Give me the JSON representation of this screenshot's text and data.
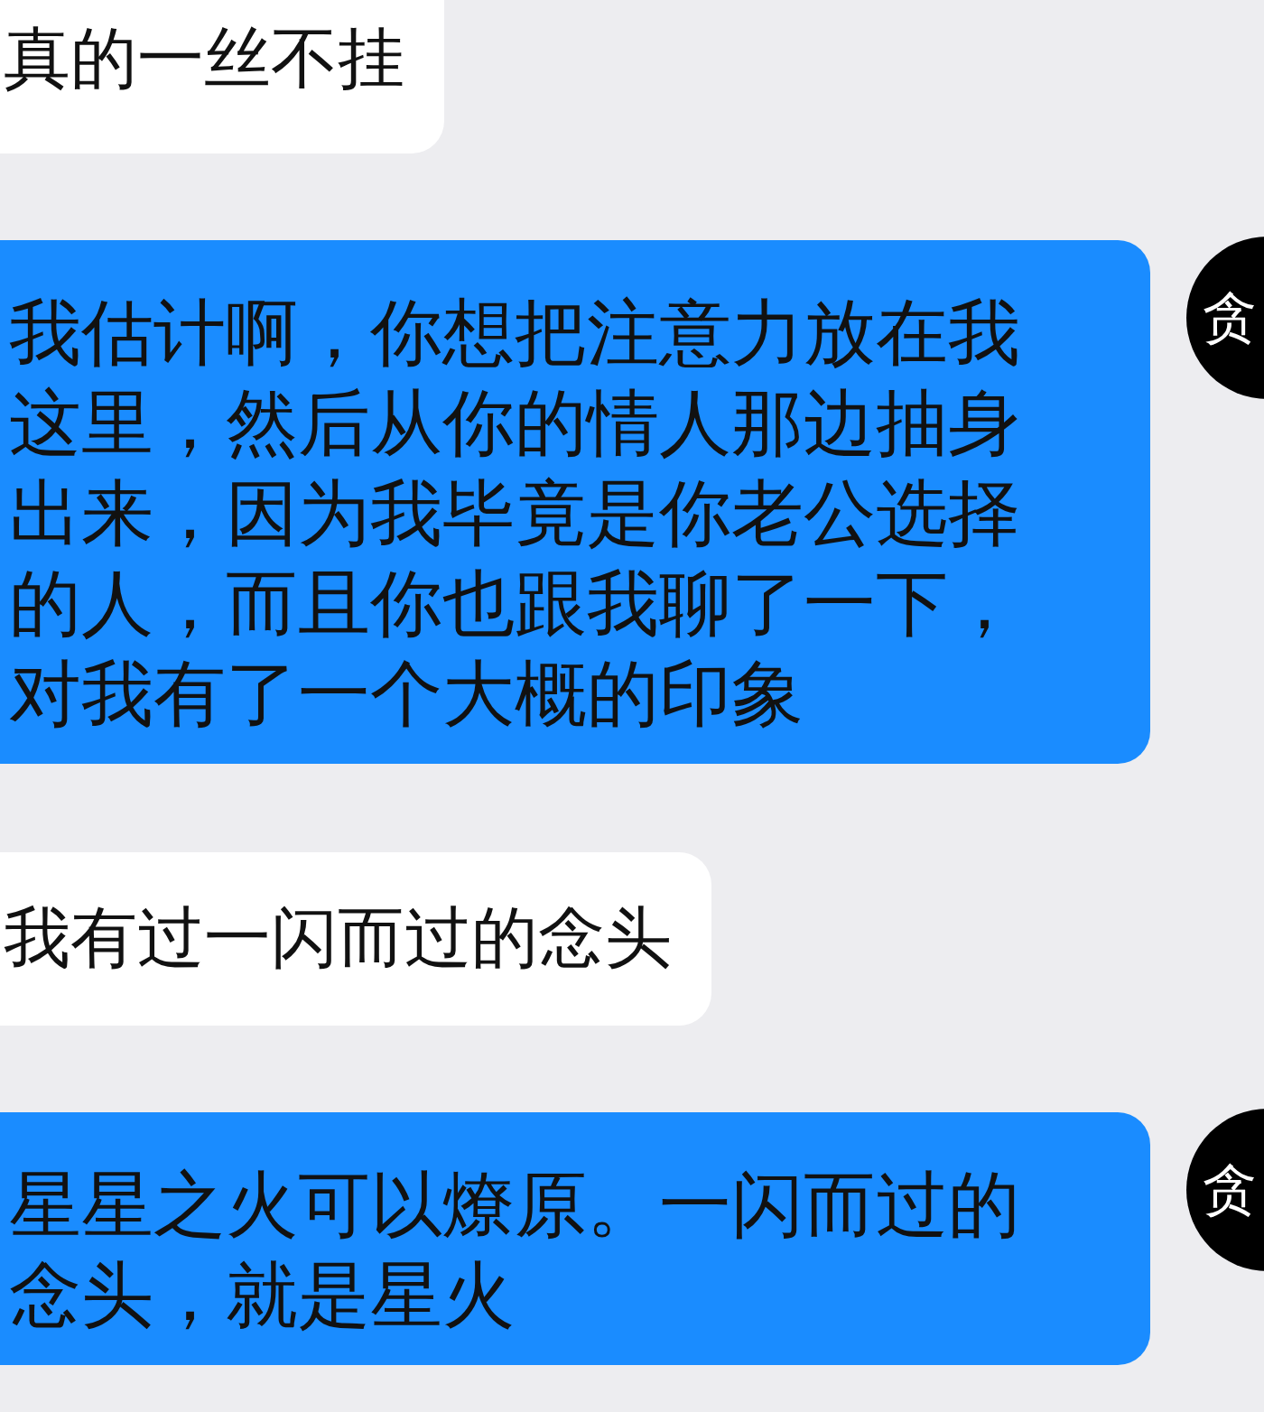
{
  "messages": [
    {
      "kind": "incoming",
      "text": "真的一丝不挂"
    },
    {
      "kind": "outgoing",
      "text": "我估计啊，你想把注意力放在我这里，然后从你的情人那边抽身出来，因为我毕竟是你老公选择的人，而且你也跟我聊了一下，对我有了一个大概的印象",
      "avatar": "贪"
    },
    {
      "kind": "incoming",
      "text": "我有过一闪而过的念头"
    },
    {
      "kind": "outgoing",
      "text": "星星之火可以燎原。一闪而过的念头，就是星火",
      "avatar": "贪"
    }
  ]
}
